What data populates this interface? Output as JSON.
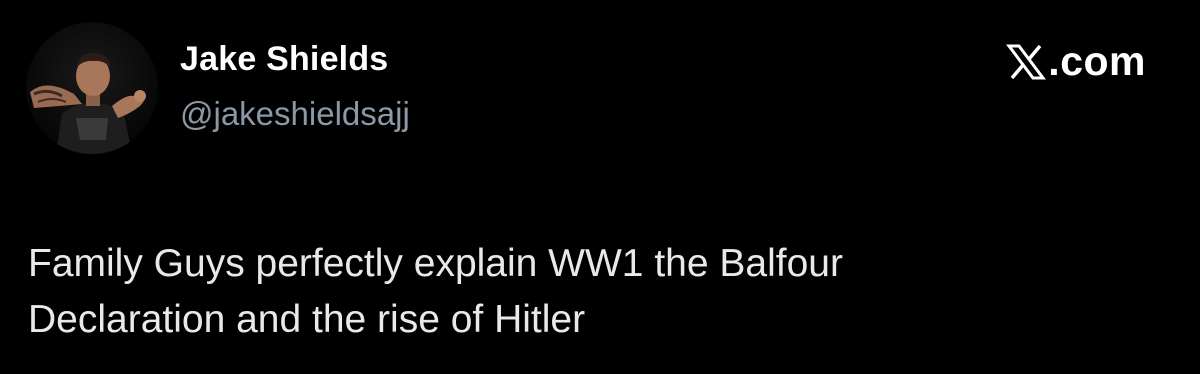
{
  "tweet": {
    "author": {
      "display_name": "Jake Shields",
      "handle": "@jakeshieldsajj"
    },
    "brand": {
      "logo_icon": "x-logo-icon",
      "label": ".com"
    },
    "text_lines": [
      "Family Guys perfectly explain WW1 the Balfour",
      "Declaration and the rise of Hitler"
    ]
  },
  "colors": {
    "background": "#000000",
    "name": "#ffffff",
    "handle": "#8b98a5",
    "body_text": "#e7e9ea"
  }
}
